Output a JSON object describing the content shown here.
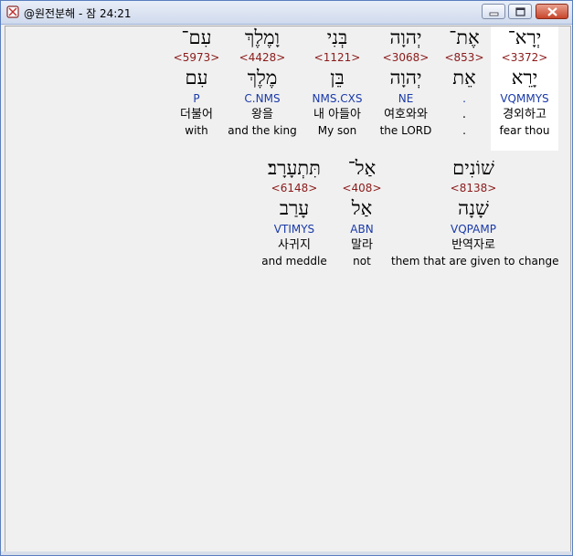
{
  "window": {
    "title": "@원전분해 - 잠 24:21",
    "controls": {
      "minimize": "minimize",
      "maximize": "maximize",
      "close": "close"
    }
  },
  "row1": [
    {
      "hebrew": "יְרָא־",
      "strong": "<3372>",
      "lemma": "יָרֵא",
      "morph": "VQMMYS",
      "korean": "경외하고",
      "english": "fear thou",
      "selected": true
    },
    {
      "hebrew": "אֶת־",
      "strong": "<853>",
      "lemma": "אֵת",
      "morph": ".",
      "korean": ".",
      "english": ".",
      "selected": false
    },
    {
      "hebrew": "יְהוָה",
      "strong": "<3068>",
      "lemma": "יְהוָה",
      "morph": "NE",
      "korean": "여호와와",
      "english": "the LORD",
      "selected": false
    },
    {
      "hebrew": "בְּנִי",
      "strong": "<1121>",
      "lemma": "בֵּן",
      "morph": "NMS.CXS",
      "korean": "내 아들아",
      "english": "My son",
      "selected": false
    },
    {
      "hebrew": "וָמֶלֶךְ",
      "strong": "<4428>",
      "lemma": "מֶלֶךְ",
      "morph": "C.NMS",
      "korean": "왕을",
      "english": "and the king",
      "selected": false
    },
    {
      "hebrew": "עִם־",
      "strong": "<5973>",
      "lemma": "עִם",
      "morph": "P",
      "korean": "더불어",
      "english": "with",
      "selected": false
    }
  ],
  "row2": [
    {
      "hebrew": "שׁוֹנִים",
      "strong": "<8138>",
      "lemma": "שָׁנָה",
      "morph": "VQPAMP",
      "korean": "반역자로",
      "english": "them that are given to change"
    },
    {
      "hebrew": "אַל־",
      "strong": "<408>",
      "lemma": "אַל",
      "morph": "ABN",
      "korean": "말라",
      "english": "not"
    },
    {
      "hebrew": "תִּתְעָרָב׃",
      "strong": "<6148>",
      "lemma": "עָרַב",
      "morph": "VTIMYS",
      "korean": "사귀지",
      "english": "and meddle"
    }
  ]
}
